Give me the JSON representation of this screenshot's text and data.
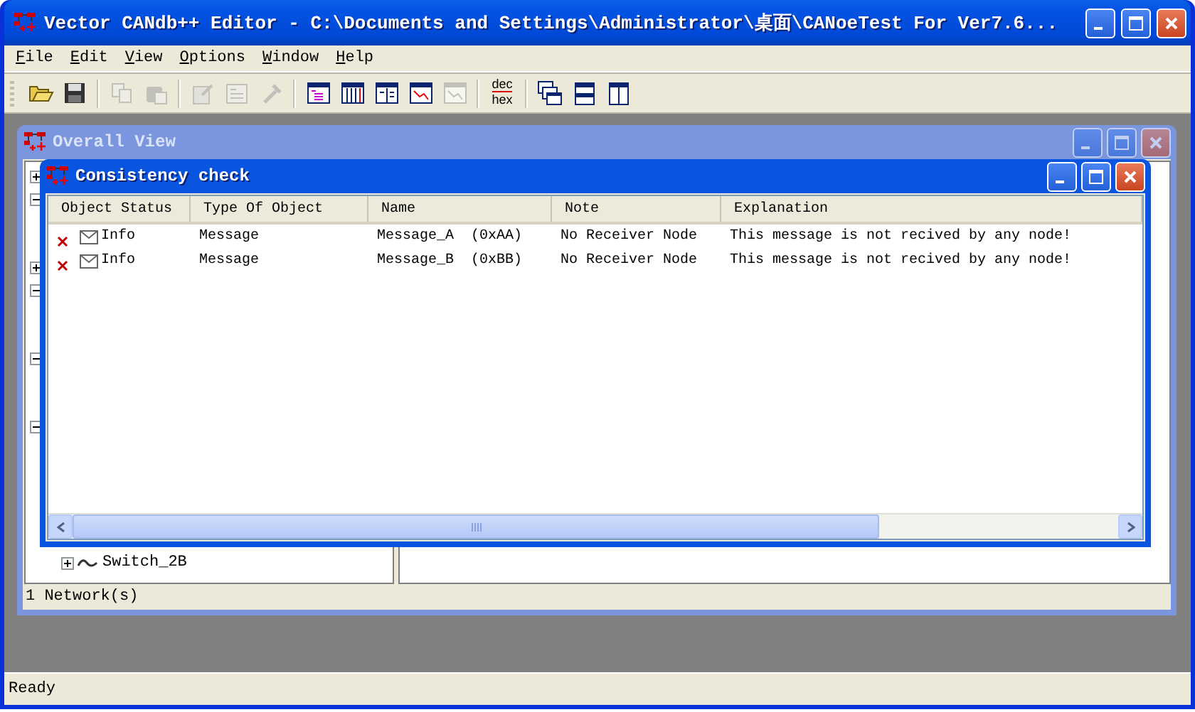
{
  "window": {
    "title": "Vector CANdb++ Editor - C:\\Documents and Settings\\Administrator\\桌面\\CANoeTest For Ver7.6..."
  },
  "menu": [
    {
      "label": "File"
    },
    {
      "label": "Edit"
    },
    {
      "label": "View"
    },
    {
      "label": "Options"
    },
    {
      "label": "Window"
    },
    {
      "label": "Help"
    }
  ],
  "toolbar": [
    {
      "kind": "open",
      "disabled": false
    },
    {
      "kind": "save",
      "disabled": false
    },
    {
      "kind": "separator"
    },
    {
      "kind": "copy",
      "disabled": true
    },
    {
      "kind": "paste",
      "disabled": true
    },
    {
      "kind": "separator"
    },
    {
      "kind": "edit",
      "disabled": true
    },
    {
      "kind": "form",
      "disabled": true
    },
    {
      "kind": "tool",
      "disabled": true
    },
    {
      "kind": "separator"
    },
    {
      "kind": "view-list",
      "disabled": false
    },
    {
      "kind": "view-table",
      "disabled": false
    },
    {
      "kind": "view-split",
      "disabled": false
    },
    {
      "kind": "view-chart",
      "disabled": false
    },
    {
      "kind": "view-chart",
      "disabled": true
    },
    {
      "kind": "separator"
    },
    {
      "kind": "dechex",
      "top": "dec",
      "bottom": "hex",
      "disabled": false
    },
    {
      "kind": "separator"
    },
    {
      "kind": "cascade",
      "disabled": false
    },
    {
      "kind": "tile-horizontal",
      "disabled": false
    },
    {
      "kind": "tile-vertical",
      "disabled": false
    }
  ],
  "overall_view": {
    "title": "Overall View",
    "active": false,
    "tree_edge": [
      {
        "expanded": false
      },
      {
        "expanded": true
      },
      {
        "expanded": false
      },
      {
        "expanded": true
      },
      {
        "expanded": true
      },
      {
        "expanded": true
      }
    ],
    "tree_bottom": {
      "label": "Switch_2B",
      "expanded": false
    },
    "status": "1 Network(s)"
  },
  "consistency_check": {
    "title": "Consistency check",
    "active": true,
    "columns": [
      "Object Status",
      "Type Of Object",
      "Name",
      "Note",
      "Explanation"
    ],
    "rows": [
      {
        "status": "Info",
        "type": "Message",
        "name": "Message_A  (0xAA)",
        "note": "No Receiver Node",
        "explanation": "This message is not recived by any node!"
      },
      {
        "status": "Info",
        "type": "Message",
        "name": "Message_B  (0xBB)",
        "note": "No Receiver Node",
        "explanation": "This message is not recived by any node!"
      }
    ]
  },
  "status_bar": "Ready"
}
